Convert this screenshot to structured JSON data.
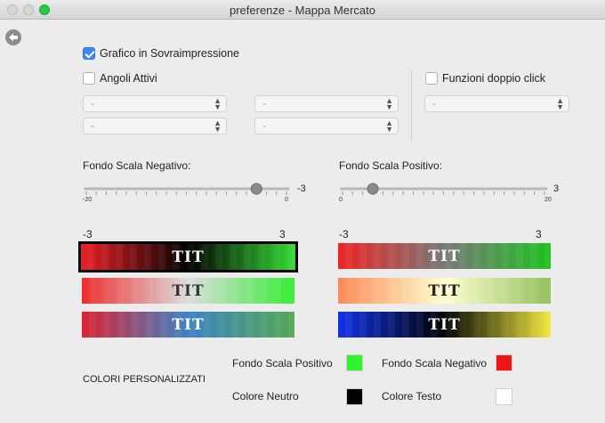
{
  "window": {
    "title": "preferenze - Mappa Mercato"
  },
  "options": {
    "overlay_chart": {
      "label": "Grafico in Sovraimpressione",
      "checked": true
    },
    "active_corners": {
      "label": "Angoli Attivi",
      "checked": false
    },
    "double_click": {
      "label": "Funzioni doppio click",
      "checked": false
    }
  },
  "selects": {
    "corner_1": "-",
    "corner_2": "-",
    "corner_3": "-",
    "corner_4": "-",
    "double_click": "-"
  },
  "negative_scale": {
    "label": "Fondo Scala Negativo:",
    "min_label": "-20",
    "max_label": "0",
    "value_label": "-3",
    "value": -3,
    "min": -20,
    "max": 0
  },
  "positive_scale": {
    "label": "Fondo Scala Positivo:",
    "min_label": "0",
    "max_label": "20",
    "value_label": "3",
    "value": 3,
    "min": 0,
    "max": 20
  },
  "preview_ranges": {
    "left": {
      "min": "-3",
      "max": "3"
    },
    "right": {
      "min": "-3",
      "max": "3"
    }
  },
  "palettes": [
    {
      "text": "TIT",
      "selected": true,
      "text_color": "#ffffff",
      "colors": [
        "#ee1f26",
        "#000000",
        "#33dd33"
      ]
    },
    {
      "text": "TIT",
      "selected": false,
      "text_color": "#333333",
      "colors": [
        "#ee2c2c",
        "#dddddd",
        "#33ee33"
      ]
    },
    {
      "text": "TIT",
      "selected": false,
      "text_color": "#ffffff",
      "colors": [
        "#dd2233",
        "#3c82c2",
        "#52a852"
      ]
    },
    {
      "text": "TIT",
      "selected": false,
      "text_color": "#ffffff",
      "colors": [
        "#ee2424",
        "#777777",
        "#1ec21e"
      ]
    },
    {
      "text": "TIT",
      "selected": false,
      "text_color": "#222222",
      "colors": [
        "#fc8a55",
        "#ffffd0",
        "#92c05a"
      ]
    },
    {
      "text": "TIT",
      "selected": false,
      "text_color": "#ffffff",
      "colors": [
        "#1131e8",
        "#000000",
        "#f2ea3c"
      ]
    }
  ],
  "custom_colors": {
    "section_label": "COLORI PERSONALIZZATI",
    "positive": {
      "label": "Fondo Scala Positivo",
      "color": "#2ef52e"
    },
    "negative": {
      "label": "Fondo Scala Negativo",
      "color": "#f01414"
    },
    "neutral": {
      "label": "Colore Neutro",
      "color": "#000000"
    },
    "text": {
      "label": "Colore Testo",
      "color": "#ffffff"
    }
  }
}
